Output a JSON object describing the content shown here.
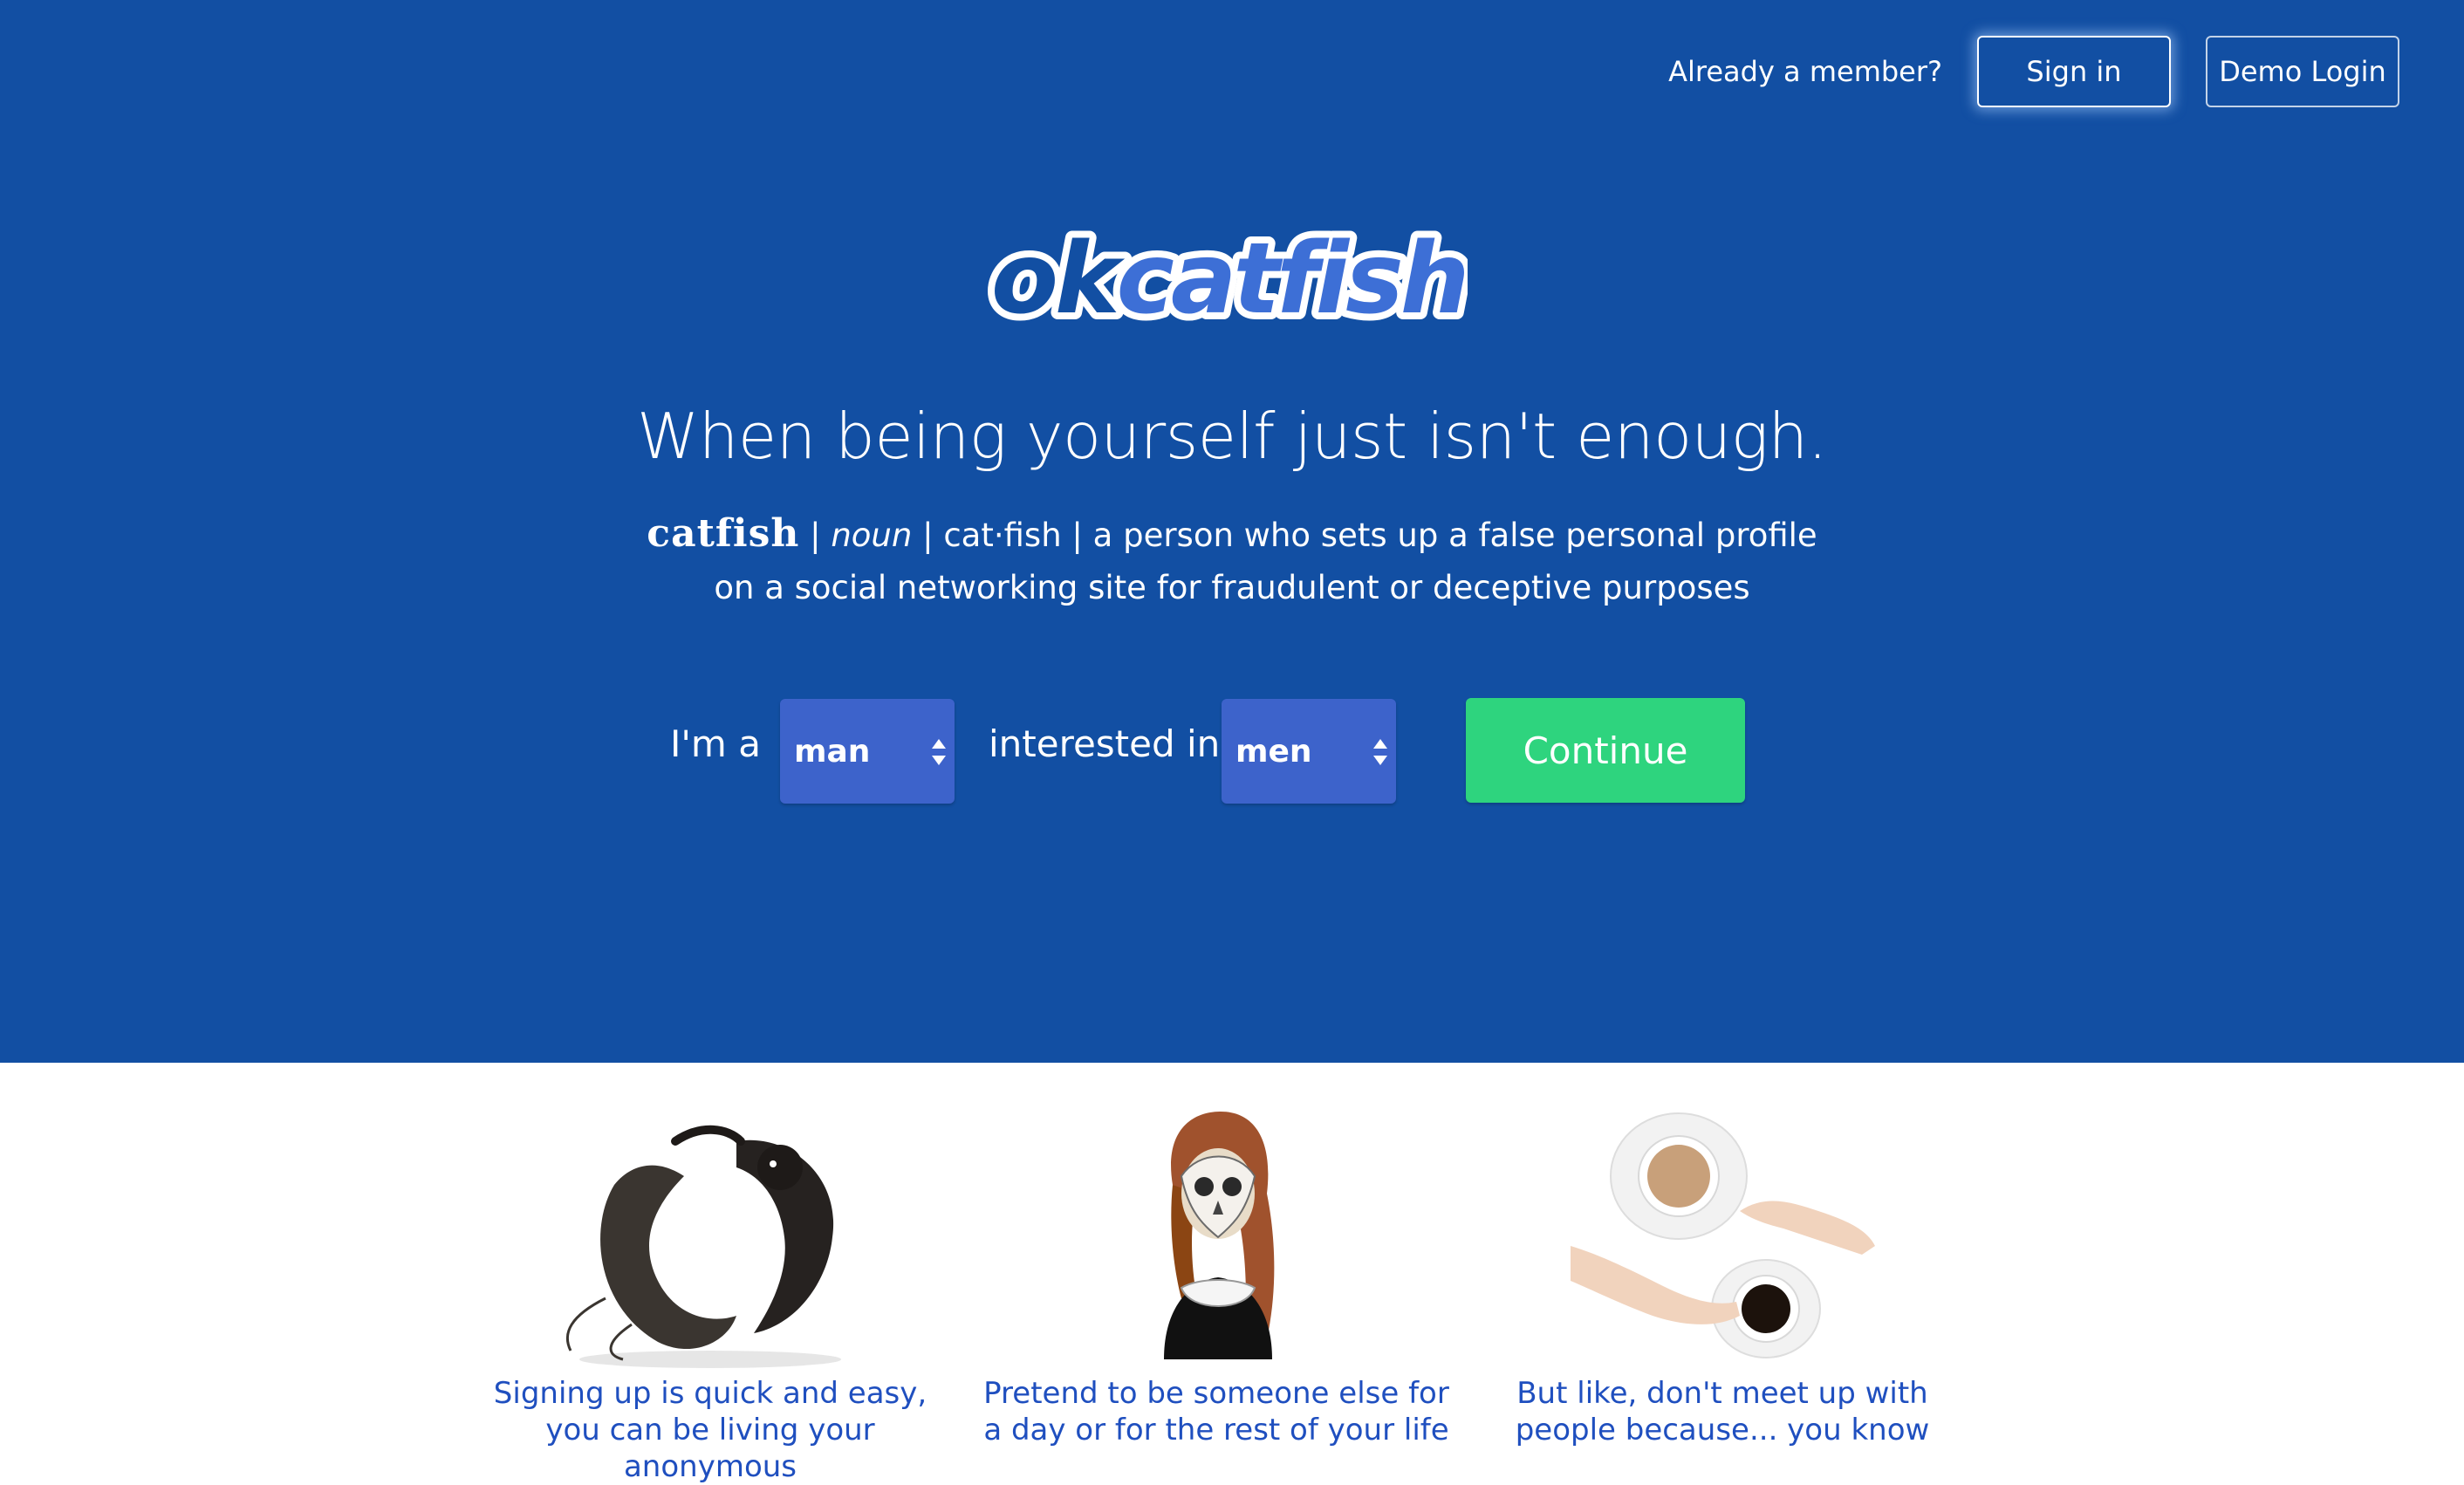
{
  "header": {
    "member_prompt": "Already a member?",
    "signin_label": "Sign in",
    "demo_label": "Demo Login"
  },
  "logo": {
    "text_ok": "ok",
    "text_catfish": "catfish"
  },
  "hero": {
    "tagline": "When being yourself just isn't enough.",
    "definition": {
      "word": "catfish",
      "sep1": "|",
      "part_of_speech": "noun",
      "sep2": "|",
      "pronunciation": "cat·fish",
      "sep3": "|",
      "meaning_line1": "a person who sets up a false personal profile",
      "meaning_line2": "on a social networking site for fraudulent or deceptive purposes"
    }
  },
  "signup_form": {
    "im_a_label": "I'm a",
    "gender_value": "man",
    "interested_label": "interested in",
    "interest_value": "men",
    "continue_label": "Continue"
  },
  "features": [
    {
      "icon": "catfish-and-cat-illustration",
      "text": "Signing up is quick and easy, you can be living your anonymous"
    },
    {
      "icon": "owl-mask-woman-illustration",
      "text": "Pretend to be someone else for a day or for the rest of your life"
    },
    {
      "icon": "coffee-cups-hands-illustration",
      "text": "But like, don't meet up with people because... you know"
    }
  ],
  "colors": {
    "hero_bg": "#124fa3",
    "select_bg": "#3d63cb",
    "continue_bg": "#2ed47e",
    "feature_text": "#1f4fbf"
  }
}
